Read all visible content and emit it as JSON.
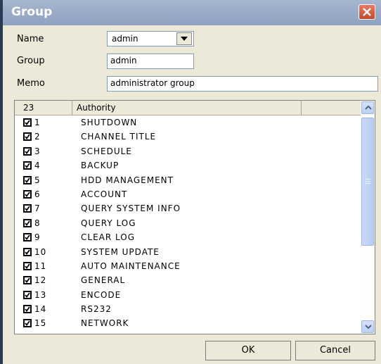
{
  "window": {
    "title": "Group"
  },
  "form": {
    "name_label": "Name",
    "name_value": "admin",
    "group_label": "Group",
    "group_value": "admin",
    "memo_label": "Memo",
    "memo_value": "administrator group"
  },
  "list": {
    "headers": [
      "23",
      "Authority",
      ""
    ],
    "rows": [
      {
        "num": "1",
        "name": "SHUTDOWN",
        "checked": true
      },
      {
        "num": "2",
        "name": "CHANNEL TITLE",
        "checked": true
      },
      {
        "num": "3",
        "name": "SCHEDULE",
        "checked": true
      },
      {
        "num": "4",
        "name": "BACKUP",
        "checked": true
      },
      {
        "num": "5",
        "name": "HDD MANAGEMENT",
        "checked": true
      },
      {
        "num": "6",
        "name": "ACCOUNT",
        "checked": true
      },
      {
        "num": "7",
        "name": "QUERY SYSTEM INFO",
        "checked": true
      },
      {
        "num": "8",
        "name": "QUERY LOG",
        "checked": true
      },
      {
        "num": "9",
        "name": "CLEAR LOG",
        "checked": true
      },
      {
        "num": "10",
        "name": "SYSTEM UPDATE",
        "checked": true
      },
      {
        "num": "11",
        "name": "AUTO MAINTENANCE",
        "checked": true
      },
      {
        "num": "12",
        "name": "GENERAL",
        "checked": true
      },
      {
        "num": "13",
        "name": "ENCODE",
        "checked": true
      },
      {
        "num": "14",
        "name": "RS232",
        "checked": true
      },
      {
        "num": "15",
        "name": "NETWORK",
        "checked": true
      }
    ]
  },
  "buttons": {
    "ok": "OK",
    "cancel": "Cancel"
  },
  "icons": {
    "close": "close-icon",
    "dropdown": "chevron-down-icon",
    "scroll_up": "chevron-up-icon",
    "scroll_down": "chevron-down-icon",
    "checkbox": "checkmark-icon"
  }
}
